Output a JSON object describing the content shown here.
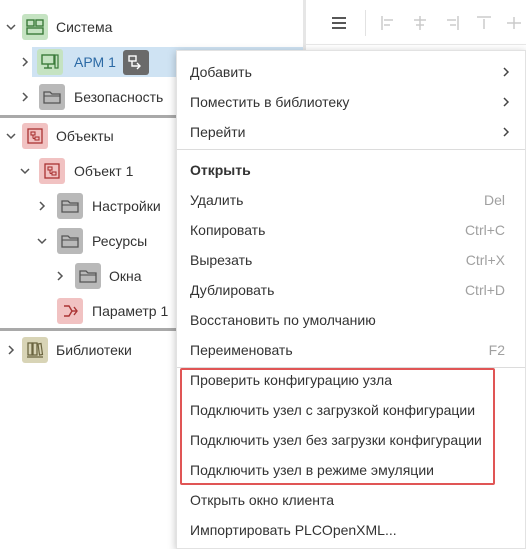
{
  "tree": {
    "items": [
      {
        "label": "Система",
        "icon": "system-icon"
      },
      {
        "label": "АРМ 1",
        "icon": "workstation-icon"
      },
      {
        "label": "Безопасность",
        "icon": "folder-icon"
      },
      {
        "label": "Объекты",
        "icon": "objects-icon"
      },
      {
        "label": "Объект 1",
        "icon": "object-icon"
      },
      {
        "label": "Настройки",
        "icon": "folder-icon"
      },
      {
        "label": "Ресурсы",
        "icon": "folder-icon"
      },
      {
        "label": "Окна",
        "icon": "folder-icon"
      },
      {
        "label": "Параметр 1",
        "icon": "parameter-icon"
      },
      {
        "label": "Библиотеки",
        "icon": "libraries-icon"
      }
    ],
    "selected": "АРМ 1",
    "colors": {
      "selected_bg": "#cfe3f3",
      "system_icon_bg": "#c5e3c2",
      "object_icon_bg": "#f1c2c2",
      "folder_icon_bg": "#b9b9b9",
      "library_icon_bg": "#d8d4b6"
    }
  },
  "toolbar": {
    "icons": [
      "menu-icon",
      "align-left-icon",
      "align-center-icon",
      "align-right-icon",
      "align-top-icon",
      "align-middle-icon"
    ]
  },
  "context_menu": {
    "items": [
      {
        "label": "Добавить",
        "submenu": true
      },
      {
        "label": "Поместить в библиотеку",
        "submenu": true
      },
      {
        "label": "Перейти",
        "submenu": true
      },
      {
        "label": "Открыть",
        "bold": true
      },
      {
        "label": "Удалить",
        "shortcut": "Del"
      },
      {
        "label": "Копировать",
        "shortcut": "Ctrl+C"
      },
      {
        "label": "Вырезать",
        "shortcut": "Ctrl+X"
      },
      {
        "label": "Дублировать",
        "shortcut": "Ctrl+D"
      },
      {
        "label": "Восстановить по умолчанию"
      },
      {
        "label": "Переименовать",
        "shortcut": "F2"
      },
      {
        "label": "Проверить конфигурацию узла"
      },
      {
        "label": "Подключить узел с загрузкой конфигурации"
      },
      {
        "label": "Подключить узел без загрузки конфигурации"
      },
      {
        "label": "Подключить узел в режиме эмуляции"
      },
      {
        "label": "Открыть окно клиента"
      },
      {
        "label": "Импортировать PLCOpenXML..."
      }
    ],
    "highlight_color": "#e05555"
  }
}
